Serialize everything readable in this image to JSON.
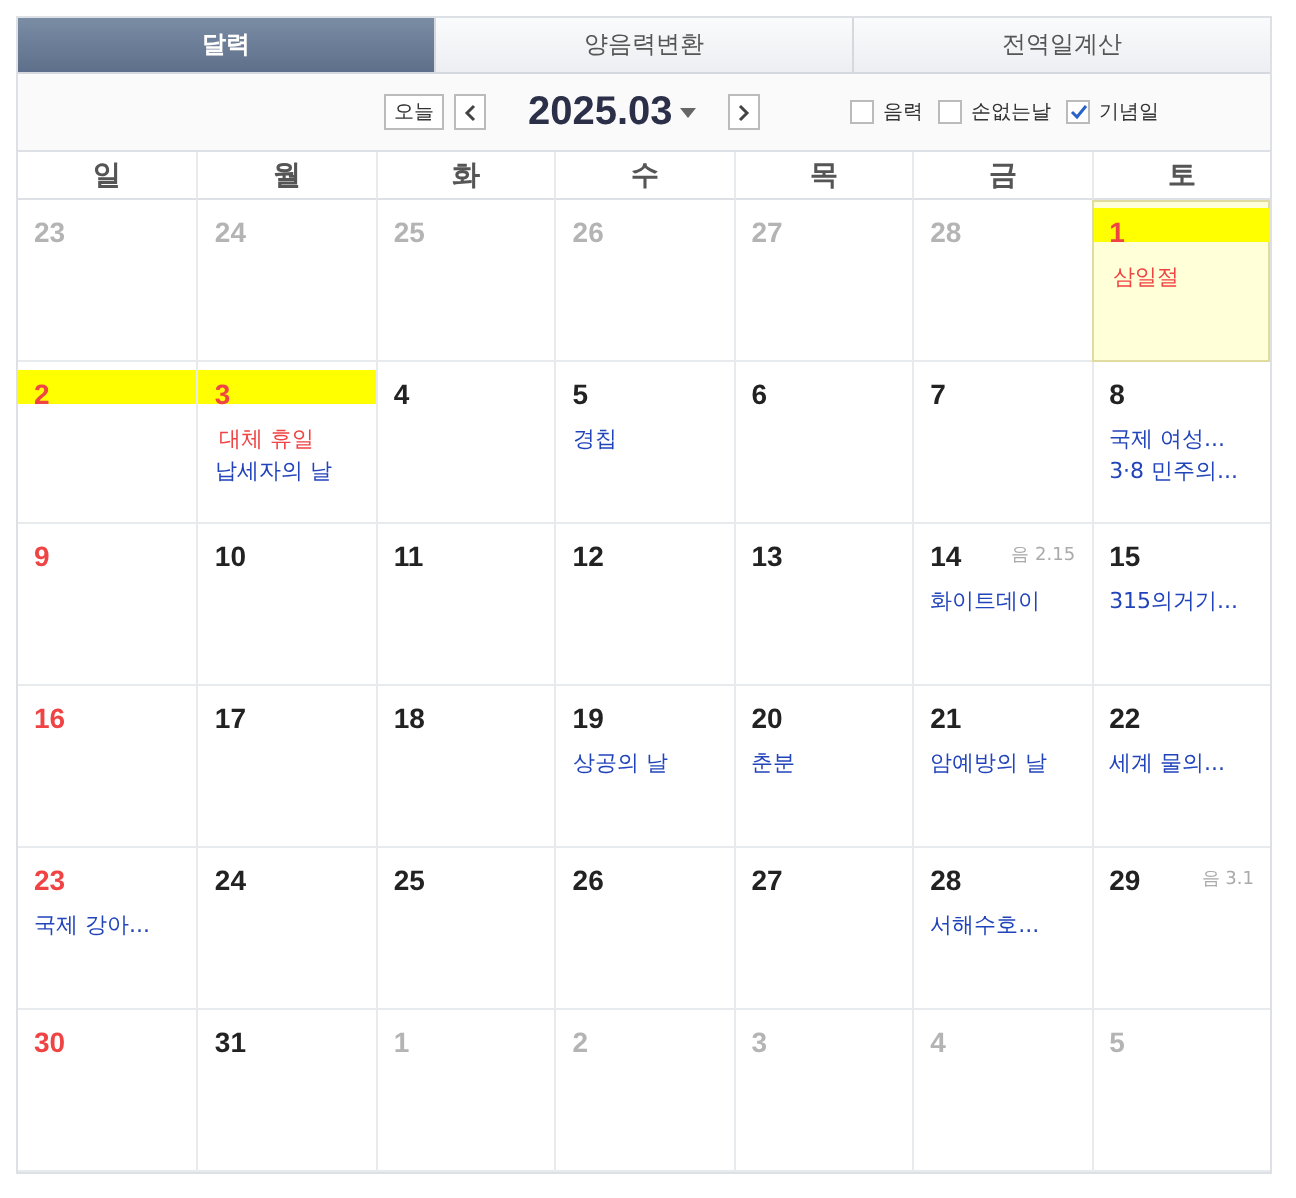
{
  "tabs": [
    {
      "label": "달력",
      "selected": true
    },
    {
      "label": "양음력변환",
      "selected": false
    },
    {
      "label": "전역일계산",
      "selected": false
    }
  ],
  "toolbar": {
    "today_button": "오늘",
    "month": "2025.03",
    "options": [
      {
        "label": "음력",
        "checked": false
      },
      {
        "label": "손없는날",
        "checked": false
      },
      {
        "label": "기념일",
        "checked": true
      }
    ]
  },
  "weekdays": [
    "일",
    "월",
    "화",
    "수",
    "목",
    "금",
    "토"
  ],
  "weeks": [
    [
      {
        "day": "23",
        "muted": true
      },
      {
        "day": "24",
        "muted": true
      },
      {
        "day": "25",
        "muted": true
      },
      {
        "day": "26",
        "muted": true
      },
      {
        "day": "27",
        "muted": true
      },
      {
        "day": "28",
        "muted": true
      },
      {
        "day": "1",
        "holiday": true,
        "today": true,
        "highlighted": true,
        "events": [
          {
            "text": "삼일절",
            "holiday": true
          }
        ]
      }
    ],
    [
      {
        "day": "2",
        "holiday": true,
        "highlighted": true
      },
      {
        "day": "3",
        "holiday": true,
        "highlighted": true,
        "events": [
          {
            "text": "대체 휴일",
            "holiday": true
          },
          {
            "text": "납세자의 날",
            "holiday": false
          }
        ]
      },
      {
        "day": "4"
      },
      {
        "day": "5",
        "events": [
          {
            "text": "경칩",
            "holiday": false
          }
        ]
      },
      {
        "day": "6"
      },
      {
        "day": "7"
      },
      {
        "day": "8",
        "events": [
          {
            "text": "국제 여성...",
            "holiday": false
          },
          {
            "text": "3·8 민주의...",
            "holiday": false
          }
        ]
      }
    ],
    [
      {
        "day": "9",
        "holiday": true
      },
      {
        "day": "10"
      },
      {
        "day": "11"
      },
      {
        "day": "12"
      },
      {
        "day": "13"
      },
      {
        "day": "14",
        "lunar": "음 2.15",
        "events": [
          {
            "text": "화이트데이",
            "holiday": false
          }
        ]
      },
      {
        "day": "15",
        "events": [
          {
            "text": "315의거기...",
            "holiday": false
          }
        ]
      }
    ],
    [
      {
        "day": "16",
        "holiday": true
      },
      {
        "day": "17"
      },
      {
        "day": "18"
      },
      {
        "day": "19",
        "events": [
          {
            "text": "상공의 날",
            "holiday": false
          }
        ]
      },
      {
        "day": "20",
        "events": [
          {
            "text": "춘분",
            "holiday": false
          }
        ]
      },
      {
        "day": "21",
        "events": [
          {
            "text": "암예방의 날",
            "holiday": false
          }
        ]
      },
      {
        "day": "22",
        "events": [
          {
            "text": "세계 물의...",
            "holiday": false
          }
        ]
      }
    ],
    [
      {
        "day": "23",
        "holiday": true,
        "events": [
          {
            "text": "국제 강아...",
            "holiday": false
          }
        ]
      },
      {
        "day": "24"
      },
      {
        "day": "25"
      },
      {
        "day": "26"
      },
      {
        "day": "27"
      },
      {
        "day": "28",
        "events": [
          {
            "text": "서해수호...",
            "holiday": false
          }
        ]
      },
      {
        "day": "29",
        "lunar": "음 3.1"
      }
    ],
    [
      {
        "day": "30",
        "holiday": true
      },
      {
        "day": "31"
      },
      {
        "day": "1",
        "muted": true
      },
      {
        "day": "2",
        "muted": true
      },
      {
        "day": "3",
        "muted": true
      },
      {
        "day": "4",
        "muted": true
      },
      {
        "day": "5",
        "muted": true
      }
    ]
  ]
}
